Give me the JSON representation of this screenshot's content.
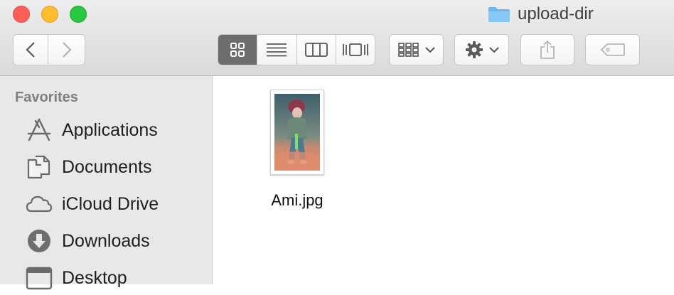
{
  "window": {
    "title": "upload-dir",
    "title_icon": "folder-icon"
  },
  "traffic_lights": {
    "close": "#fe5f57",
    "minimize": "#febc2e",
    "maximize": "#28c840"
  },
  "toolbar": {
    "back_icon": "chevron-left-icon",
    "forward_icon": "chevron-right-icon",
    "view_modes": [
      "icon-view",
      "list-view",
      "column-view",
      "cover-flow-view"
    ],
    "active_view": "icon-view",
    "arrange_icon": "arrange-grid-icon",
    "action_icon": "gear-icon",
    "share_icon": "share-icon",
    "tag_icon": "tag-icon"
  },
  "sidebar": {
    "heading": "Favorites",
    "items": [
      {
        "label": "Applications",
        "icon": "applications-icon"
      },
      {
        "label": "Documents",
        "icon": "documents-icon"
      },
      {
        "label": "iCloud Drive",
        "icon": "cloud-icon"
      },
      {
        "label": "Downloads",
        "icon": "downloads-icon"
      },
      {
        "label": "Desktop",
        "icon": "desktop-icon"
      }
    ]
  },
  "files": [
    {
      "name": "Ami.jpg",
      "kind": "image-thumbnail"
    }
  ]
}
